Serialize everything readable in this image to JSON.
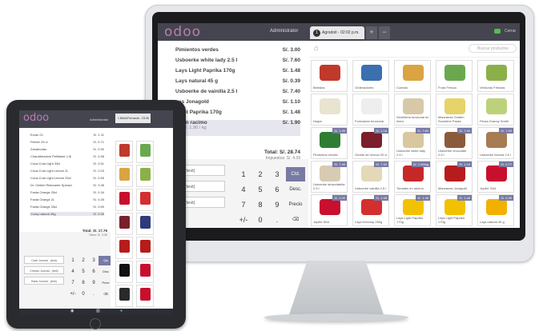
{
  "imac": {
    "logo": "odoo",
    "user": "Administrator",
    "tab": {
      "num": "1",
      "label": "Agrodoit - 02:02 p.m."
    },
    "plus": "+",
    "minus": "−",
    "close": "Cerrar",
    "search_placeholder": "Buscar productos",
    "order_lines": [
      {
        "name": "Pimientos verdes",
        "price": "S/. 3.00"
      },
      {
        "name": "Usboerke white lady 2.5 l",
        "price": "S/. 7.60"
      },
      {
        "name": "Lays Light Paprika 170g",
        "price": "S/. 1.48"
      },
      {
        "name": "Lays natural 45 g",
        "price": "S/. 0.39"
      },
      {
        "name": "Usboerke de vainilla 2.5 l",
        "price": "S/. 7.40"
      },
      {
        "name": "nas Jonagold",
        "price": "S/. 1.10"
      },
      {
        "name": "Light Paprika 170g",
        "price": "S/. 1.48"
      },
      {
        "name": "es en racimo",
        "price": "S/. 1.90",
        "sub": "g a S/. 1.90 / kg",
        "selected": true
      }
    ],
    "total": "Total: S/. 28.74",
    "tax": "Impuestos: S/. 4.39",
    "journals": [
      "Journal - (test)",
      "Journal - (test)",
      "Journal - (test)"
    ],
    "keys": [
      "1",
      "2",
      "3",
      "Ctd.",
      "4",
      "5",
      "6",
      "Desc.",
      "7",
      "8",
      "9",
      "Precio",
      "+/-",
      "0",
      ".",
      "⌫"
    ],
    "products": [
      {
        "name": "Bebidas",
        "price": "",
        "color": "#c0392b"
      },
      {
        "name": "Ordenadores",
        "price": "",
        "color": "#3a6fb0"
      },
      {
        "name": "Comida",
        "price": "",
        "color": "#d9a441"
      },
      {
        "name": "Fruta Fresca",
        "price": "",
        "color": "#6aa84f"
      },
      {
        "name": "Verduras Frescas",
        "price": "",
        "color": "#8bb04a"
      },
      {
        "name": "Hogar",
        "price": "",
        "color": "#e9e4d0"
      },
      {
        "name": "Formación funcional",
        "price": "",
        "color": "#eeeeee"
      },
      {
        "name": "Semillería funcional en línea",
        "price": "",
        "color": "#d7c9a7"
      },
      {
        "name": "Manzanas Golden Sunshine Packs",
        "price": "",
        "color": "#e6d36a"
      },
      {
        "name": "Peras Granny Smith",
        "price": "",
        "color": "#bcd27a"
      },
      {
        "name": "Pimientos verdes",
        "price": "S/. 1.90",
        "color": "#2e7d32"
      },
      {
        "name": "Griotte de cereza 25 cl",
        "price": "S/. 1.18",
        "color": "#7a1f2b"
      },
      {
        "name": "Usboerke white lady 2.5 l",
        "price": "S/. 7.60",
        "color": "#d9c7a0"
      },
      {
        "name": "Usboerke chocolate 2.5 l",
        "price": "S/. 7.40",
        "color": "#8a5a3b"
      },
      {
        "name": "Usboerke Mocha 2.5 l",
        "price": "S/. 7.20",
        "color": "#a67c52"
      },
      {
        "name": "Usboerke stracciatella 2.5 l",
        "price": "S/. 7.40",
        "color": "#d8cbb3"
      },
      {
        "name": "Usboerke vainilla 2.5 l",
        "price": "S/. 7.40",
        "color": "#e5d8b8"
      },
      {
        "name": "Tomates en racimo",
        "price": "S/. 1.90/kg",
        "color": "#c62828"
      },
      {
        "name": "Manzanas Jonagold",
        "price": "S/. 1.10",
        "color": "#b71c1c"
      },
      {
        "name": "Jupiler 33cl",
        "price": "S/. 0.77",
        "color": "#c8102e"
      },
      {
        "name": "Jupiler 50cl",
        "price": "S/. 1.00",
        "color": "#c8102e"
      },
      {
        "name": "Lays Ketchup 250g",
        "price": "S/. 1.48",
        "color": "#d32f2f"
      },
      {
        "name": "Lays Light Paprika 170g",
        "price": "S/. 1.48",
        "color": "#f2c200"
      },
      {
        "name": "Lays Light Paprika 170g",
        "price": "S/. 1.48",
        "color": "#f2c200"
      },
      {
        "name": "Lays natural 45 g",
        "price": "S/. 0.39",
        "color": "#f2b100"
      }
    ]
  },
  "ipad": {
    "logo": "odoo",
    "user": "Administrator",
    "tab": "1 Bikini/Fernando - 03:36 p.m.",
    "order_lines": [
      {
        "name": "Ecran 21",
        "price": "S/. 1.11"
      },
      {
        "name": "Perrier 25 cl",
        "price": "S/. 0.71"
      },
      {
        "name": "Zanahorias",
        "price": "S/. 0.90"
      },
      {
        "name": "Chaudfontaine Petillante 1.5l",
        "price": "S/. 0.98"
      },
      {
        "name": "Coca-Cola Light 33cl",
        "price": "S/. 0.51"
      },
      {
        "name": "Coca-Cola Light Lemon 2L",
        "price": "S/. 2.03"
      },
      {
        "name": "Coca-Cola Light Lemon 33cl",
        "price": "S/. 0.55"
      },
      {
        "name": "Dr. Oetker Ristorante Spinaci",
        "price": "S/. 3.36"
      },
      {
        "name": "Fanta Orange 25cl",
        "price": "S/. 0.34"
      },
      {
        "name": "Fanta Orange 2L",
        "price": "S/. 0.39"
      },
      {
        "name": "Fanta Orange 33cl",
        "price": "S/. 0.59"
      },
      {
        "name": "Croky natural 45g",
        "price": "S/. 0.39",
        "selected": true
      }
    ],
    "total": "Total: S/. 17.76",
    "tax": "Taxes: S/. 3.08",
    "journals": [
      "Cash Journal - (test)",
      "Checks Journal - (test)",
      "Bank Journal - (test)"
    ],
    "keys": [
      "1",
      "2",
      "3",
      "Qty",
      "4",
      "5",
      "6",
      "Disc",
      "7",
      "8",
      "9",
      "Price",
      "+/-",
      "0",
      ".",
      "⌫"
    ],
    "products": [
      {
        "color": "#c0392b"
      },
      {
        "color": "#6aa84f"
      },
      {
        "color": "#d9a441"
      },
      {
        "color": "#8bb04a"
      },
      {
        "color": "#c8102e"
      },
      {
        "color": "#d32f2f"
      },
      {
        "color": "#7a1f2b"
      },
      {
        "color": "#2e3a7a"
      },
      {
        "color": "#b71c1c"
      },
      {
        "color": "#b71c1c"
      },
      {
        "color": "#111111"
      },
      {
        "color": "#c8102e"
      },
      {
        "color": "#2a2a2a"
      },
      {
        "color": "#c8102e"
      }
    ]
  }
}
